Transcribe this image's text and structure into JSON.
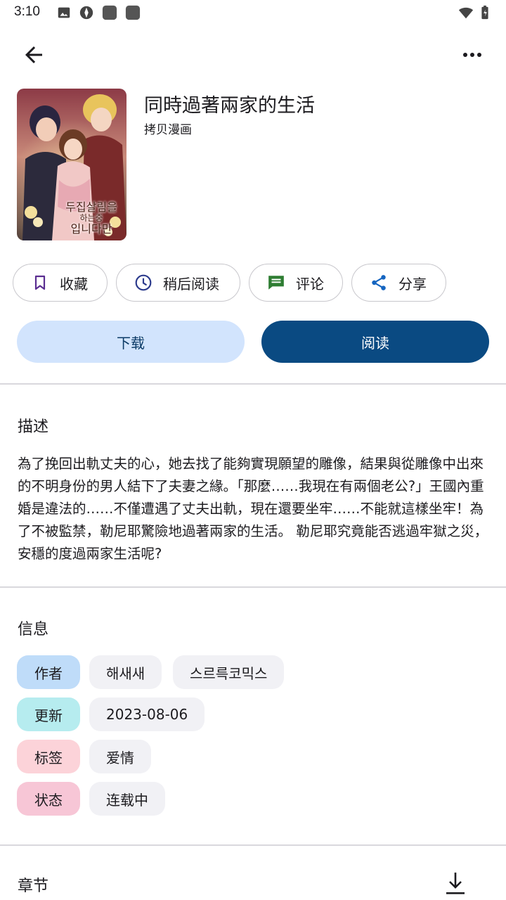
{
  "status_bar": {
    "time": "3:10"
  },
  "top_bar": {
    "back_icon": "arrow-left-icon",
    "more_icon": "more-horizontal-icon"
  },
  "manga": {
    "title": "同時過著兩家的生活",
    "source": "拷贝漫画",
    "cover_text": [
      "두집살림을",
      "하는중",
      "입니다만"
    ]
  },
  "actions": {
    "favorite": "收藏",
    "read_later": "稍后阅读",
    "comment": "评论",
    "share": "分享",
    "download": "下载",
    "read": "阅读"
  },
  "description": {
    "heading": "描述",
    "text": "為了挽回出軌丈夫的心，她去找了能夠實現願望的雕像，結果與從雕像中出來的不明身份的男人結下了夫妻之緣。「那麼……我現在有兩個老公?」王國內重婚是違法的……不僅遭遇了丈夫出軌，現在還要坐牢……不能就這樣坐牢！為了不被監禁，勒尼耶驚險地過著兩家的生活。 勒尼耶究竟能否逃過牢獄之災，安穩的度過兩家生活呢?"
  },
  "info": {
    "heading": "信息",
    "rows": [
      {
        "key": "作者",
        "key_color": "#bfdcf9",
        "values": [
          "해새새",
          "스르륵코믹스"
        ]
      },
      {
        "key": "更新",
        "key_color": "#b6ecef",
        "values": [
          "2023-08-06"
        ]
      },
      {
        "key": "标签",
        "key_color": "#fcd3d9",
        "values": [
          "爱情"
        ]
      },
      {
        "key": "状态",
        "key_color": "#f7c6d6",
        "values": [
          "连载中"
        ]
      }
    ]
  },
  "chapters": {
    "heading": "章节",
    "download_icon": "download-icon"
  },
  "colors": {
    "primary": "#0a4a82",
    "primary_container": "#d2e4fd",
    "favorite_icon": "#5b2e91",
    "comment_icon": "#2e7d32",
    "share_icon": "#1565c0"
  }
}
